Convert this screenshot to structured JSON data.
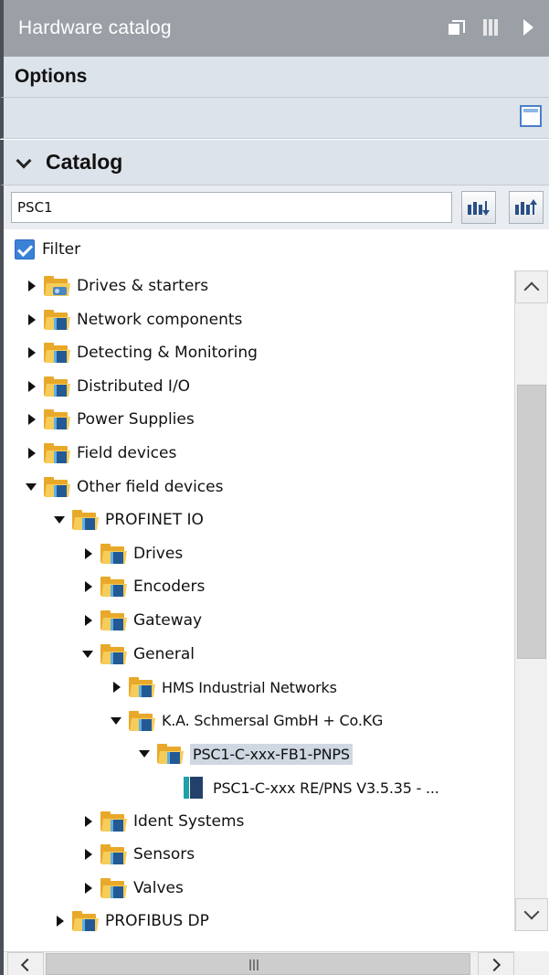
{
  "window": {
    "title": "Hardware catalog",
    "controls": [
      "restore-icon",
      "columns-icon",
      "arrow-right-icon"
    ]
  },
  "options": {
    "label": "Options",
    "tool_icon": "window-icon"
  },
  "catalog": {
    "label": "Catalog",
    "search_value": "PSC1",
    "search_buttons": [
      "search-down-icon",
      "search-up-icon"
    ],
    "filter_label": "Filter",
    "filter_checked": true
  },
  "tree": {
    "items": [
      {
        "label": "Drives & starters",
        "level": 0,
        "state": "collapsed",
        "icon": "drives-folder-icon"
      },
      {
        "label": "Network components",
        "level": 0,
        "state": "collapsed",
        "icon": "folder-icon"
      },
      {
        "label": "Detecting & Monitoring",
        "level": 0,
        "state": "collapsed",
        "icon": "folder-icon"
      },
      {
        "label": "Distributed I/O",
        "level": 0,
        "state": "collapsed",
        "icon": "folder-icon"
      },
      {
        "label": "Power Supplies",
        "level": 0,
        "state": "collapsed",
        "icon": "folder-icon"
      },
      {
        "label": "Field devices",
        "level": 0,
        "state": "collapsed",
        "icon": "folder-icon"
      },
      {
        "label": "Other field devices",
        "level": 0,
        "state": "expanded",
        "icon": "folder-icon"
      },
      {
        "label": "PROFINET IO",
        "level": 1,
        "state": "expanded",
        "icon": "folder-icon"
      },
      {
        "label": "Drives",
        "level": 2,
        "state": "collapsed",
        "icon": "folder-icon"
      },
      {
        "label": "Encoders",
        "level": 2,
        "state": "collapsed",
        "icon": "folder-icon"
      },
      {
        "label": "Gateway",
        "level": 2,
        "state": "collapsed",
        "icon": "folder-icon"
      },
      {
        "label": "General",
        "level": 2,
        "state": "expanded",
        "icon": "folder-icon"
      },
      {
        "label": "HMS Industrial Networks",
        "level": 3,
        "state": "collapsed",
        "icon": "folder-icon"
      },
      {
        "label": "K.A. Schmersal GmbH + Co.KG",
        "level": 3,
        "state": "expanded",
        "icon": "folder-icon"
      },
      {
        "label": "PSC1-C-xxx-FB1-PNPS",
        "level": 4,
        "state": "expanded",
        "icon": "folder-icon",
        "selected": true
      },
      {
        "label": "PSC1-C-xxx RE/PNS V3.5.35 - ...",
        "level": 5,
        "state": "none",
        "icon": "device-icon"
      },
      {
        "label": "Ident Systems",
        "level": 2,
        "state": "collapsed",
        "icon": "folder-icon"
      },
      {
        "label": "Sensors",
        "level": 2,
        "state": "collapsed",
        "icon": "folder-icon"
      },
      {
        "label": "Valves",
        "level": 2,
        "state": "collapsed",
        "icon": "folder-icon"
      },
      {
        "label": "PROFIBUS DP",
        "level": 1,
        "state": "collapsed",
        "icon": "folder-icon"
      }
    ]
  }
}
